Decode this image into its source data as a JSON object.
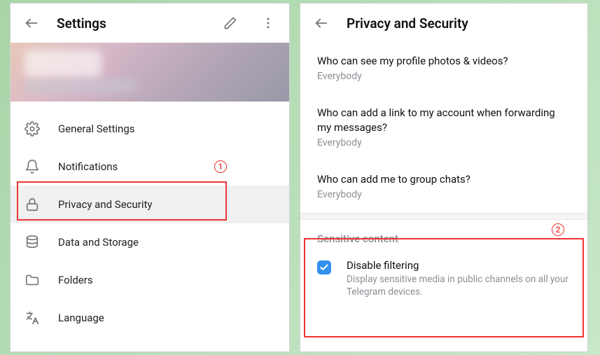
{
  "left": {
    "title": "Settings",
    "items": [
      {
        "label": "General Settings",
        "icon": "gear"
      },
      {
        "label": "Notifications",
        "icon": "bell"
      },
      {
        "label": "Privacy and Security",
        "icon": "lock",
        "selected": true
      },
      {
        "label": "Data and Storage",
        "icon": "database"
      },
      {
        "label": "Folders",
        "icon": "folder"
      },
      {
        "label": "Language",
        "icon": "language"
      }
    ]
  },
  "right": {
    "title": "Privacy and Security",
    "privacy": [
      {
        "question": "Who can see my profile photos & videos?",
        "value": "Everybody"
      },
      {
        "question": "Who can add a link to my account when forwarding my messages?",
        "value": "Everybody"
      },
      {
        "question": "Who can add me to group chats?",
        "value": "Everybody"
      }
    ],
    "sensitive": {
      "heading": "Sensitive content",
      "checkbox_label": "Disable filtering",
      "checkbox_desc": "Display sensitive media in public channels on all your Telegram devices.",
      "checked": true
    }
  },
  "callouts": {
    "one": "1",
    "two": "2"
  }
}
